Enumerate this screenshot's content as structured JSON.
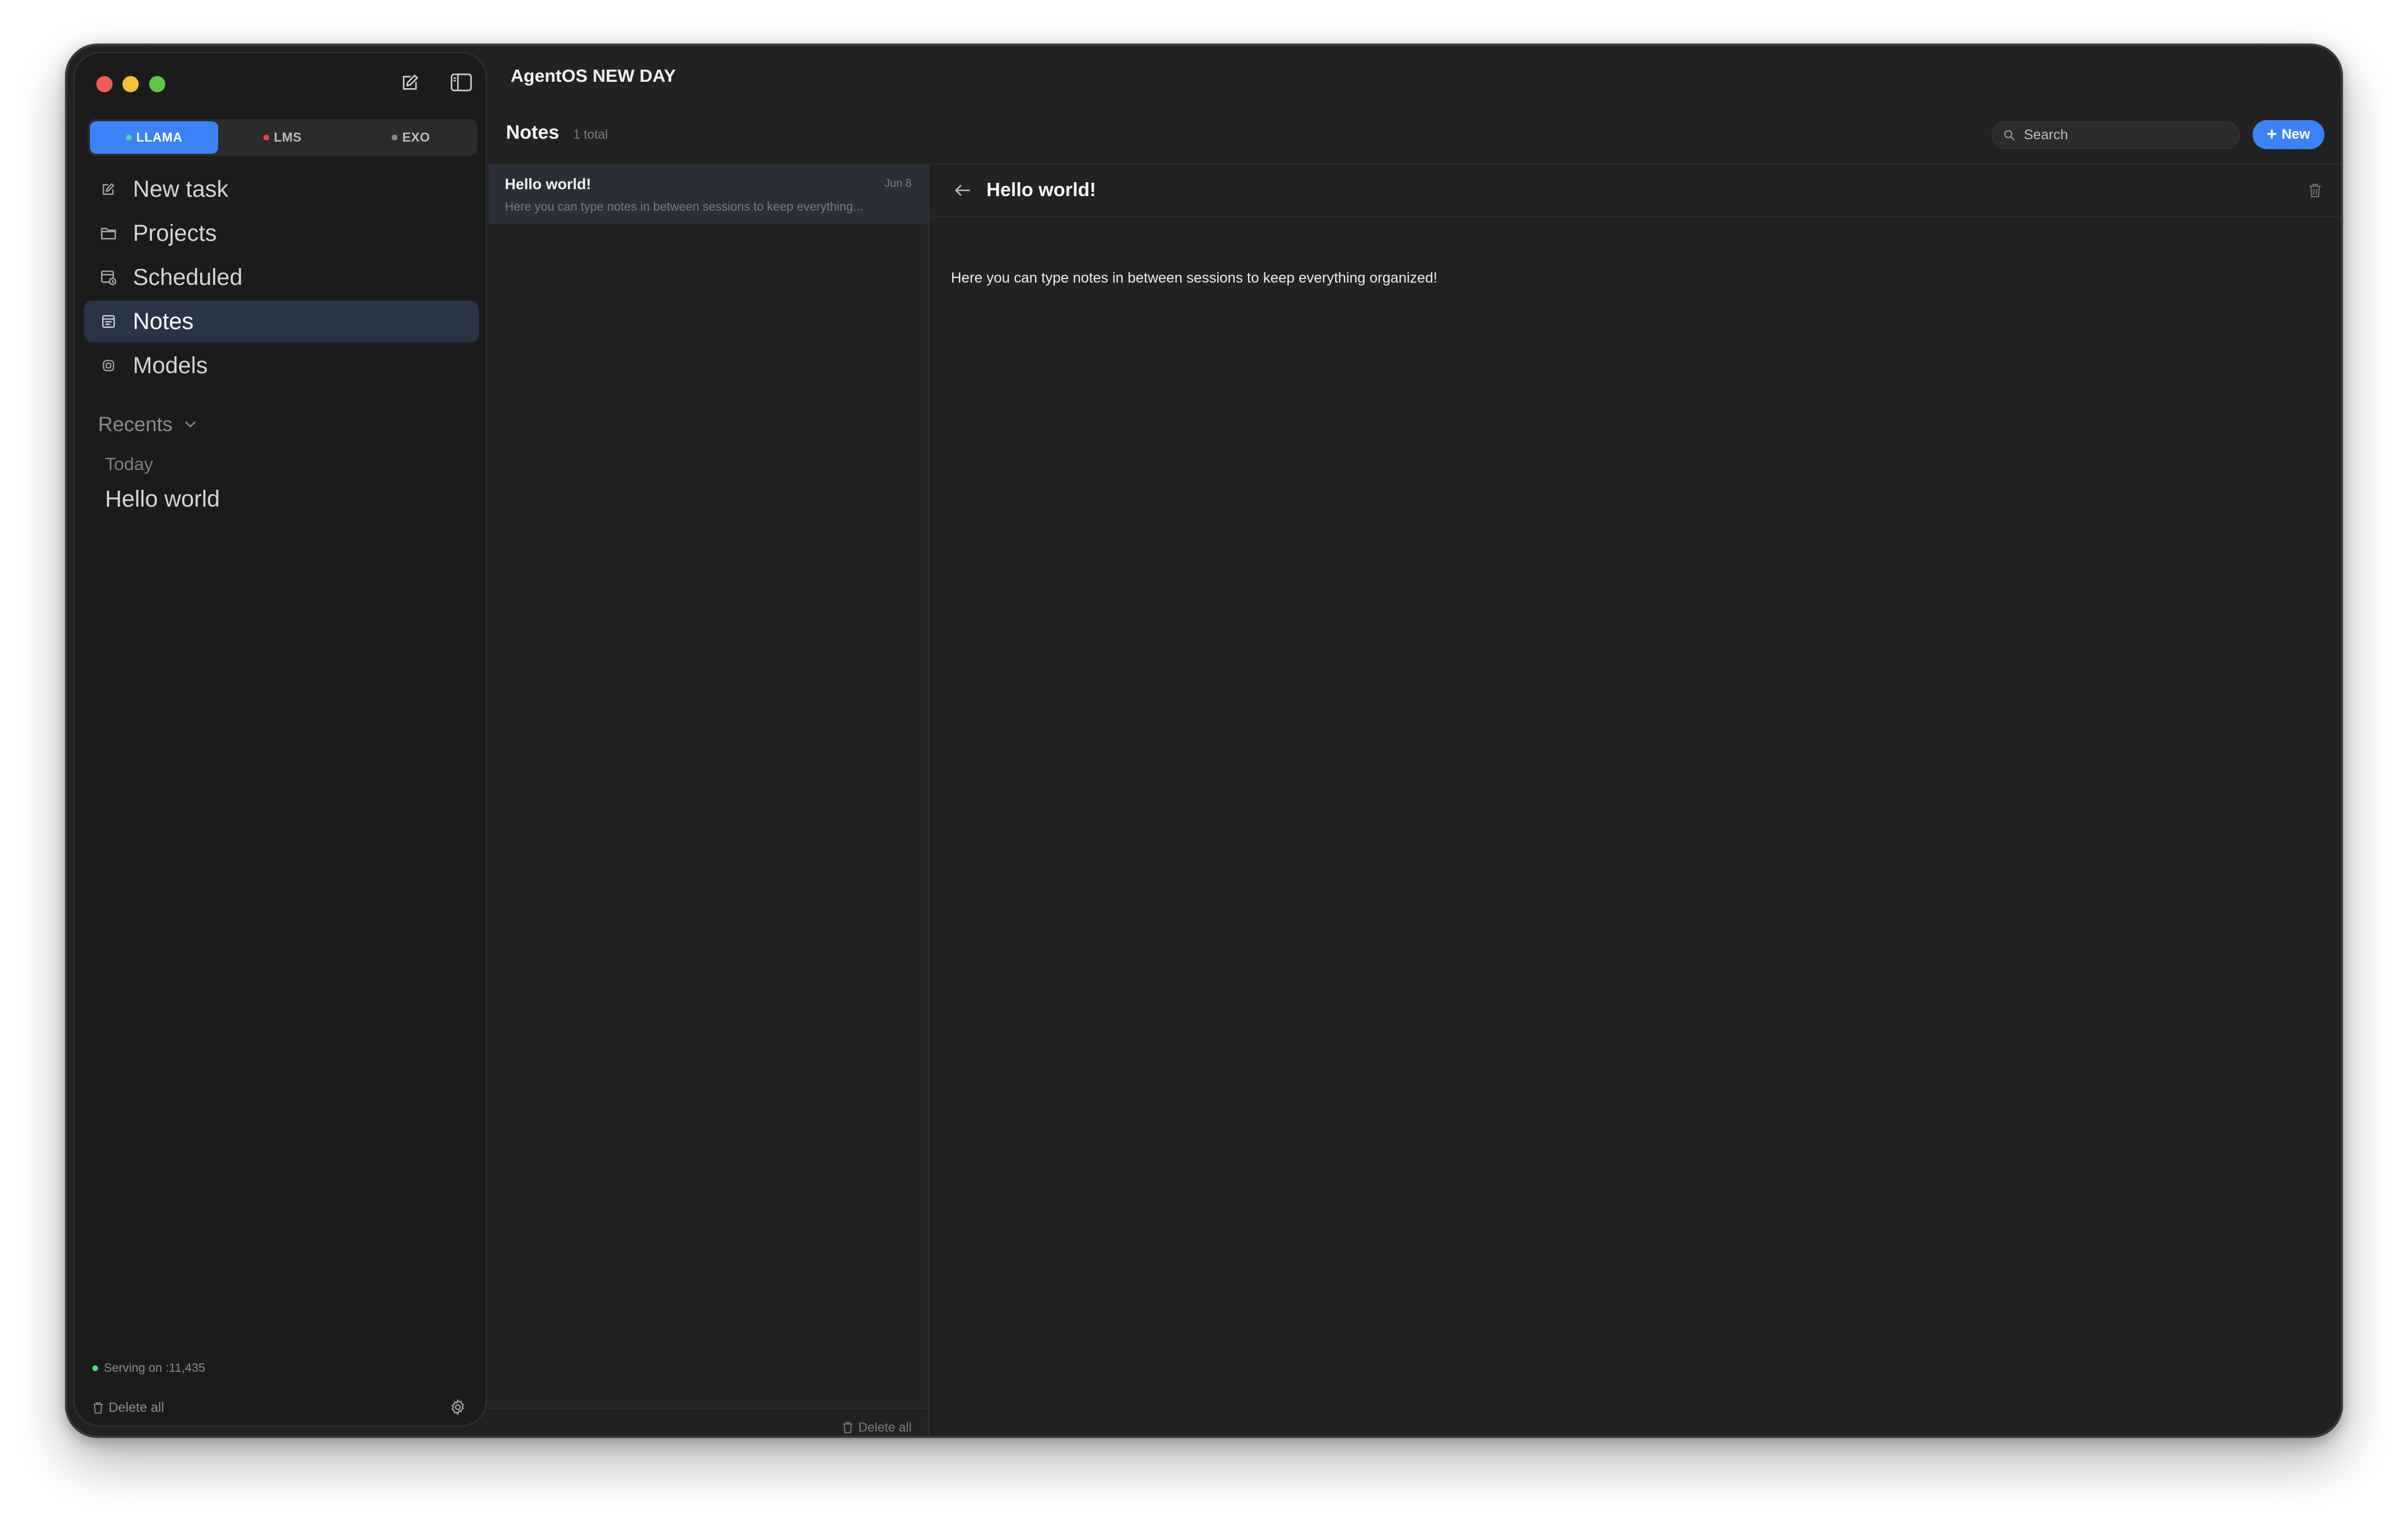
{
  "window": {
    "title": "AgentOS NEW DAY"
  },
  "sidebar": {
    "server_tabs": [
      {
        "label": "LLAMA",
        "status_color": "#4ade80",
        "active": true
      },
      {
        "label": "LMS",
        "status_color": "#ef4444",
        "active": false
      },
      {
        "label": "EXO",
        "status_color": "#8a8a8a",
        "active": false
      }
    ],
    "nav": [
      {
        "label": "New task",
        "icon": "edit-icon"
      },
      {
        "label": "Projects",
        "icon": "folder-icon"
      },
      {
        "label": "Scheduled",
        "icon": "calendar-clock-icon"
      },
      {
        "label": "Notes",
        "icon": "notes-icon",
        "active": true
      },
      {
        "label": "Models",
        "icon": "chip-icon"
      }
    ],
    "recents": {
      "label": "Recents",
      "group": "Today",
      "items": [
        "Hello world"
      ]
    },
    "status": "Serving on :11,435",
    "delete_all": "Delete all"
  },
  "notes": {
    "title": "Notes",
    "count": "1 total",
    "search_placeholder": "Search",
    "new_label": "New",
    "list": [
      {
        "title": "Hello world!",
        "date": "Jun 8",
        "snippet": "Here you can type notes in between sessions to keep everything..."
      }
    ],
    "list_delete_all": "Delete all"
  },
  "detail": {
    "title": "Hello world!",
    "body": "Here you can type notes in between sessions to keep everything organized!"
  },
  "colors": {
    "accent": "#3b82f6",
    "background": "#222222",
    "sidebar": "#1b1b1b",
    "active_nav": "#2a3447"
  }
}
